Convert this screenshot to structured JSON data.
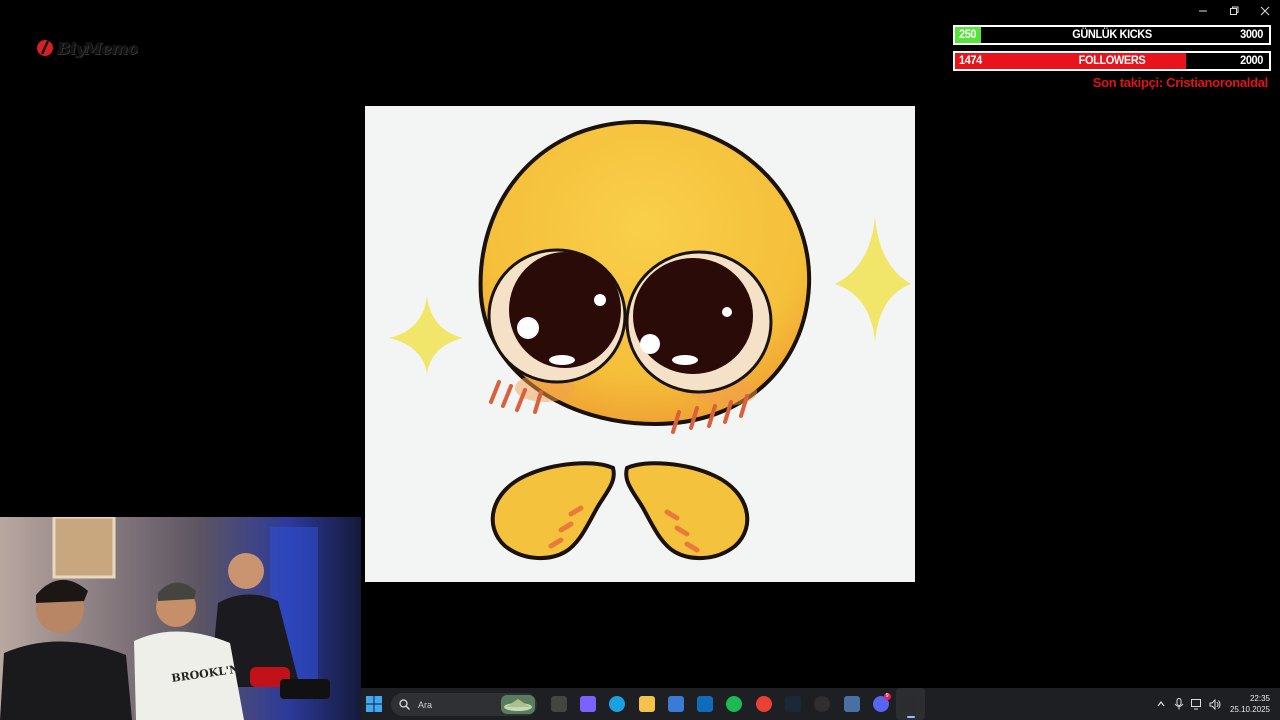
{
  "window": {
    "controls": [
      "minimize-icon",
      "restore-icon",
      "close-icon"
    ]
  },
  "logo": {
    "text": "BiyMemo"
  },
  "overlay": {
    "kicks": {
      "current": "250",
      "label": "GÜNLÜK KICKS",
      "goal": "3000",
      "progress": 0.083,
      "fill_color": "#55e33c"
    },
    "followers": {
      "current": "1474",
      "label": "FOLLOWERS",
      "goal": "2000",
      "progress": 0.737,
      "fill_color": "#e8131b"
    },
    "last_follower": "Son takipçi: Cristianoronaldal"
  },
  "main_image": {
    "subject": "cute-emoji-sticker",
    "colors": {
      "face": "#f6c43f",
      "sparkle": "#f1e56a",
      "background": "#f3f4f4"
    }
  },
  "webcam": {
    "subject": "three-people-streaming"
  },
  "taskbar": {
    "search_placeholder": "Ara",
    "apps": [
      {
        "name": "task-view",
        "color": "#444"
      },
      {
        "name": "copilot",
        "color": "#7b61ff"
      },
      {
        "name": "edge",
        "color": "#1ba1e2"
      },
      {
        "name": "file-explorer",
        "color": "#f2c14e"
      },
      {
        "name": "microsoft-store",
        "color": "#3a7bd5"
      },
      {
        "name": "outlook",
        "color": "#0f6cbd"
      },
      {
        "name": "spotify",
        "color": "#1db954"
      },
      {
        "name": "chrome",
        "color": "#e94235"
      },
      {
        "name": "steam",
        "color": "#1b2838"
      },
      {
        "name": "obs",
        "color": "#302e31"
      },
      {
        "name": "app-grid",
        "color": "#4a6fa5"
      },
      {
        "name": "discord",
        "color": "#5865f2",
        "badge": "9"
      },
      {
        "name": "media-player",
        "color": "#2a2c30",
        "active": true
      }
    ],
    "tray_icons": [
      "chevron-up-icon",
      "microphone-icon",
      "network-icon",
      "volume-icon"
    ],
    "time": "22:35",
    "date": "25.10.2025"
  }
}
